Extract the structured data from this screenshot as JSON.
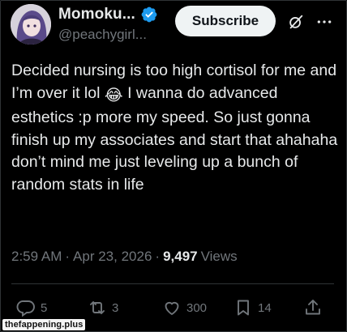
{
  "user": {
    "display_name": "Momoku...",
    "handle": "@peachygirl...",
    "verified": true
  },
  "header": {
    "subscribe_label": "Subscribe"
  },
  "tweet": {
    "text_before_emoji": "Decided nursing is too high cortisol for me and I’m over it lol ",
    "emoji": "😂",
    "text_after_emoji": " I wanna do advanced esthetics :p more my speed. So just gonna finish up my associates and start that ahahaha don’t mind me just leveling up a bunch of random stats in life"
  },
  "meta": {
    "time": "2:59 AM",
    "sep1": "·",
    "date": "Apr 23, 2026",
    "sep2": "·",
    "views_count": "9,497",
    "views_label": "Views"
  },
  "actions": {
    "replies": "5",
    "reposts": "3",
    "likes": "300",
    "bookmarks": "14"
  },
  "watermark": "thefappening.plus",
  "colors": {
    "background": "#000000",
    "text": "#e7e9ea",
    "secondary": "#71767b",
    "verified": "#1d9bf0",
    "subscribe_bg": "#eff3f4"
  }
}
